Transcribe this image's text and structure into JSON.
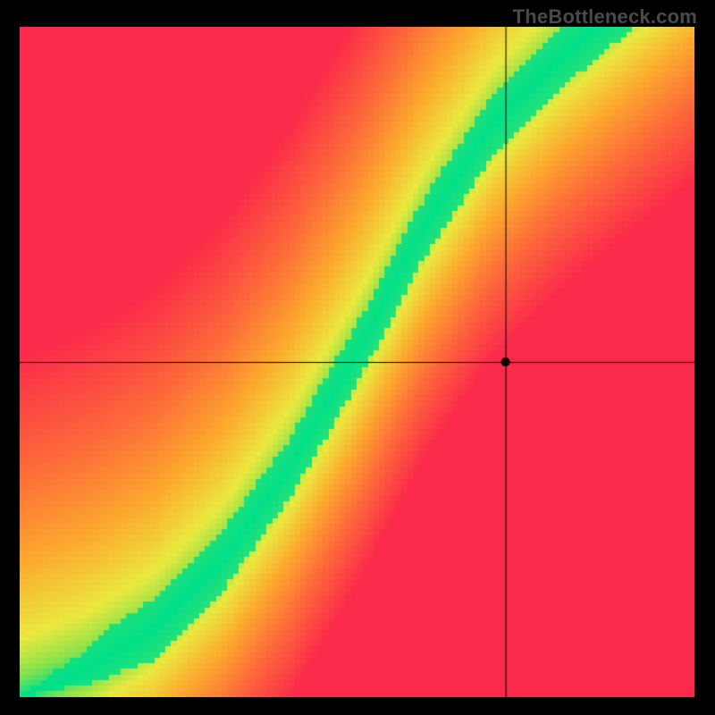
{
  "watermark": "TheBottleneck.com",
  "chart_data": {
    "type": "heatmap",
    "title": "",
    "xlabel": "",
    "ylabel": "",
    "xlim": [
      0,
      1
    ],
    "ylim": [
      0,
      1
    ],
    "crosshair": {
      "x": 0.72,
      "y": 0.5
    },
    "marker": {
      "x": 0.72,
      "y": 0.5
    },
    "optimal_curve": {
      "description": "Green ideal ridge: y-position as a function of x (both 0..1, y=0 at bottom).",
      "points": [
        {
          "x": 0.0,
          "y": 0.0
        },
        {
          "x": 0.1,
          "y": 0.04
        },
        {
          "x": 0.2,
          "y": 0.1
        },
        {
          "x": 0.3,
          "y": 0.2
        },
        {
          "x": 0.4,
          "y": 0.34
        },
        {
          "x": 0.5,
          "y": 0.51
        },
        {
          "x": 0.6,
          "y": 0.7
        },
        {
          "x": 0.7,
          "y": 0.85
        },
        {
          "x": 0.8,
          "y": 0.95
        },
        {
          "x": 0.86,
          "y": 1.0
        }
      ]
    },
    "ridge_halfwidth": 0.045,
    "color_stops": [
      {
        "t": 0.0,
        "color": "#00e08a"
      },
      {
        "t": 0.1,
        "color": "#8de24a"
      },
      {
        "t": 0.22,
        "color": "#ebe93f"
      },
      {
        "t": 0.45,
        "color": "#fca82e"
      },
      {
        "t": 0.7,
        "color": "#fd6a3a"
      },
      {
        "t": 1.0,
        "color": "#fb2a4a"
      }
    ],
    "pixelation": 120
  }
}
